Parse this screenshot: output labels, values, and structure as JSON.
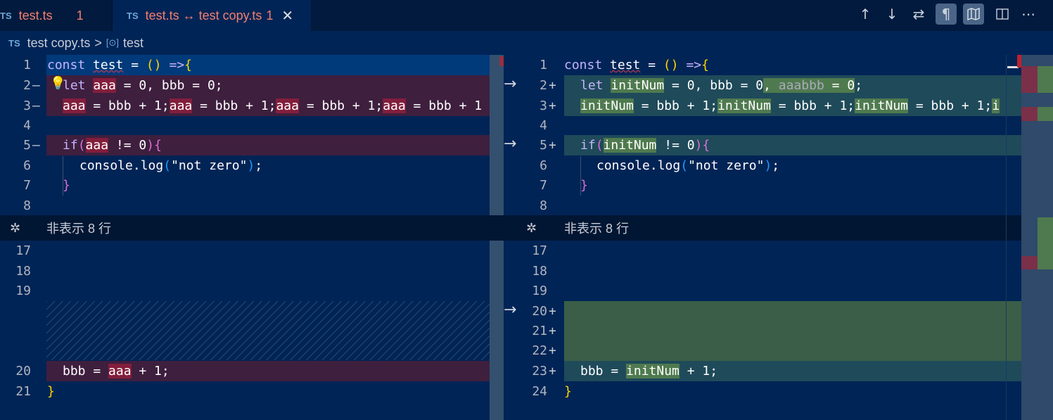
{
  "tabs": [
    {
      "icon": "TS",
      "label": "test.ts",
      "count": "1"
    },
    {
      "icon": "TS",
      "label": "test.ts ↔ test copy.ts",
      "count": "1",
      "close": "✕"
    }
  ],
  "toolbar_icons": [
    "arrow-up-icon",
    "arrow-down-icon",
    "swap-icon",
    "pilcrow-icon",
    "map-icon",
    "split-editor-icon",
    "more-icon"
  ],
  "breadcrumb": {
    "file": "test copy.ts",
    "separator": ">",
    "symbol": "test",
    "symbol_icon": "[⊙]"
  },
  "hidden_lines_label": "非表示 8 行",
  "left": {
    "line_numbers": [
      "1",
      "2",
      "3",
      "4",
      "5",
      "6",
      "7",
      "8",
      "17",
      "18",
      "19",
      "20",
      "21"
    ],
    "lines": {
      "l1": "const test = () =>{",
      "l2": "let aaa = 0, bbb = 0;",
      "l3": "aaa = bbb + 1;aaa = bbb + 1;aaa = bbb + 1;aaa = bbb + 1",
      "l5": "if(aaa != 0){",
      "l6": "console.log(\"not zero\");",
      "l7": "}",
      "l20": "bbb = aaa + 1;",
      "l21": "}"
    }
  },
  "right": {
    "line_numbers": [
      "1",
      "2",
      "3",
      "4",
      "5",
      "6",
      "7",
      "8",
      "17",
      "18",
      "19",
      "20",
      "21",
      "22",
      "23",
      "24"
    ],
    "lines": {
      "l1": "const test = () =>{",
      "l2": "let initNum = 0, bbb = 0, aaabbb = 0;",
      "l3": "initNum = bbb + 1;initNum = bbb + 1;initNum = bbb + 1;",
      "l5": "if(initNum != 0){",
      "l6": "console.log(\"not zero\");",
      "l7": "}",
      "l23": "bbb = initNum + 1;",
      "l24": "}"
    }
  },
  "colors": {
    "background": "#012456",
    "removed": "#821e3c",
    "inserted": "#3a6b4a"
  }
}
